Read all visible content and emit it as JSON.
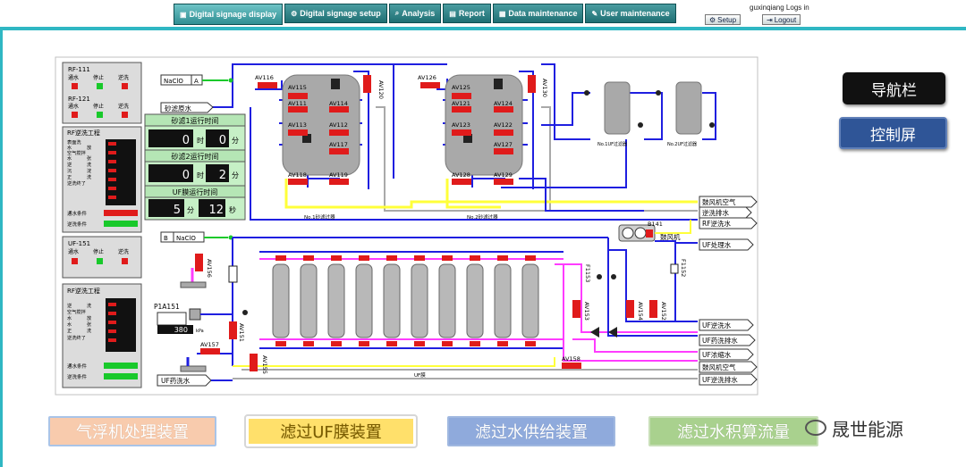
{
  "tabs": [
    {
      "icon": "monitor-icon",
      "label": "Digital signage display",
      "active": true
    },
    {
      "icon": "gear-icon",
      "label": "Digital signage setup"
    },
    {
      "icon": "magnifier-icon",
      "label": "Analysis"
    },
    {
      "icon": "document-icon",
      "label": "Report"
    },
    {
      "icon": "database-icon",
      "label": "Data maintenance"
    },
    {
      "icon": "wrench-icon",
      "label": "User maintenance"
    }
  ],
  "login_text": "guxinqiang Logs in",
  "setup_label": "Setup",
  "logout_label": "Logout",
  "nav_label": "导航栏",
  "ctrl_label": "控制屏",
  "bottom_buttons": [
    "气浮机处理装置",
    "滤过UF膜装置",
    "滤过水供给装置",
    "滤过水积算流量"
  ],
  "brand": "晟世能源",
  "panels": {
    "rf111": {
      "title": "RF-111",
      "cols": [
        "通水",
        "停止",
        "逆洗"
      ]
    },
    "rf121": {
      "title": "RF-121",
      "cols": [
        "通水",
        "停止",
        "逆洗"
      ]
    },
    "rf_process": {
      "title": "RF逆洗工程",
      "steps": [
        "表面洗",
        "水",
        "放",
        "空气搅拌",
        "水",
        "张",
        "逆",
        "洗",
        "沉",
        "淀",
        "正",
        "洗",
        "逆洗终了"
      ],
      "footer": [
        "通水条件",
        "逆洗条件"
      ]
    },
    "uf151": {
      "title": "UF-151",
      "cols": [
        "通水",
        "停止",
        "逆洗"
      ]
    },
    "uf_process": {
      "title": "RF逆洗工程",
      "steps": [
        "逆",
        "洗",
        "空气搅拌",
        "水",
        "放",
        "水",
        "张",
        "正",
        "洗",
        "逆洗终了"
      ],
      "footer": [
        "通水条件",
        "逆洗条件"
      ]
    }
  },
  "timers": {
    "sand1_title": "砂滤1运行时间",
    "sand1_h": "0",
    "sand1_m": "0",
    "sand2_title": "砂滤2运行时间",
    "sand2_h": "0",
    "sand2_m": "2",
    "uf_title": "UF膜运行时间",
    "uf_m": "5",
    "uf_s": "12",
    "unit_h": "时",
    "unit_m": "分",
    "unit_s": "秒"
  },
  "pipe_labels": {
    "naclo_a": "NaClO",
    "naclo_a_tag": "A",
    "sand_raw": "砂滤原水",
    "naclo_b_tag": "B",
    "naclo_b": "NaClO",
    "blower_air": "鼓风机空气",
    "backwash_drain": "逆洗排水",
    "rf_backwash_water": "RF逆洗水",
    "uf_treat_water": "UF处理水",
    "uf_backwash_water": "UF逆洗水",
    "uf_chem_wash_water": "UF药洗排水",
    "uf_conc_water": "UF浓缩水",
    "blower_air2": "鼓风机空气",
    "uf_backwash_drain": "UF逆洗排水",
    "uf_chem_wash": "UF药洗水",
    "blower": "鼓风机",
    "filter1": "No.1砂滤过器",
    "filter2": "No.2砂滤过器",
    "tank1": "No.1UF过滤器",
    "tank2": "No.2UF过滤器",
    "uf_group": "UF膜"
  },
  "valves": {
    "av116": "AV116",
    "av115": "AV115",
    "av111": "AV111",
    "av114": "AV114",
    "av113": "AV113",
    "av112": "AV112",
    "av117": "AV117",
    "av118": "AV118",
    "av119": "AV119",
    "av120": "AV120",
    "av126": "AV126",
    "av125": "AV125",
    "av121": "AV121",
    "av124": "AV124",
    "av123": "AV123",
    "av122": "AV122",
    "av127": "AV127",
    "av128": "AV128",
    "av129": "AV129",
    "av130": "AV130",
    "b141": "B141",
    "av156": "AV156",
    "av151": "AV151",
    "av157": "AV157",
    "av155": "AV155",
    "av158": "AV158",
    "av153": "AV153",
    "av154": "AV154",
    "av152": "AV152",
    "f1153": "F1153",
    "f1152": "F1152",
    "p1a151": "P1A151",
    "pressure_value": "380",
    "pressure_unit": "kPa"
  },
  "colors": {
    "blue_pipe": "#1f1fe0",
    "yellow_pipe": "#ffff3a",
    "magenta_pipe": "#ff3cff",
    "gray_pipe": "#a9a9a9",
    "valve_red": "#e0121c",
    "panel_gray": "#dcdcdc",
    "panel_green": "#c6f0c6",
    "led_green": "#19c92b",
    "led_red": "#e01b1b",
    "teal_line": "#2fb7c3"
  },
  "uf_module_count": 10
}
